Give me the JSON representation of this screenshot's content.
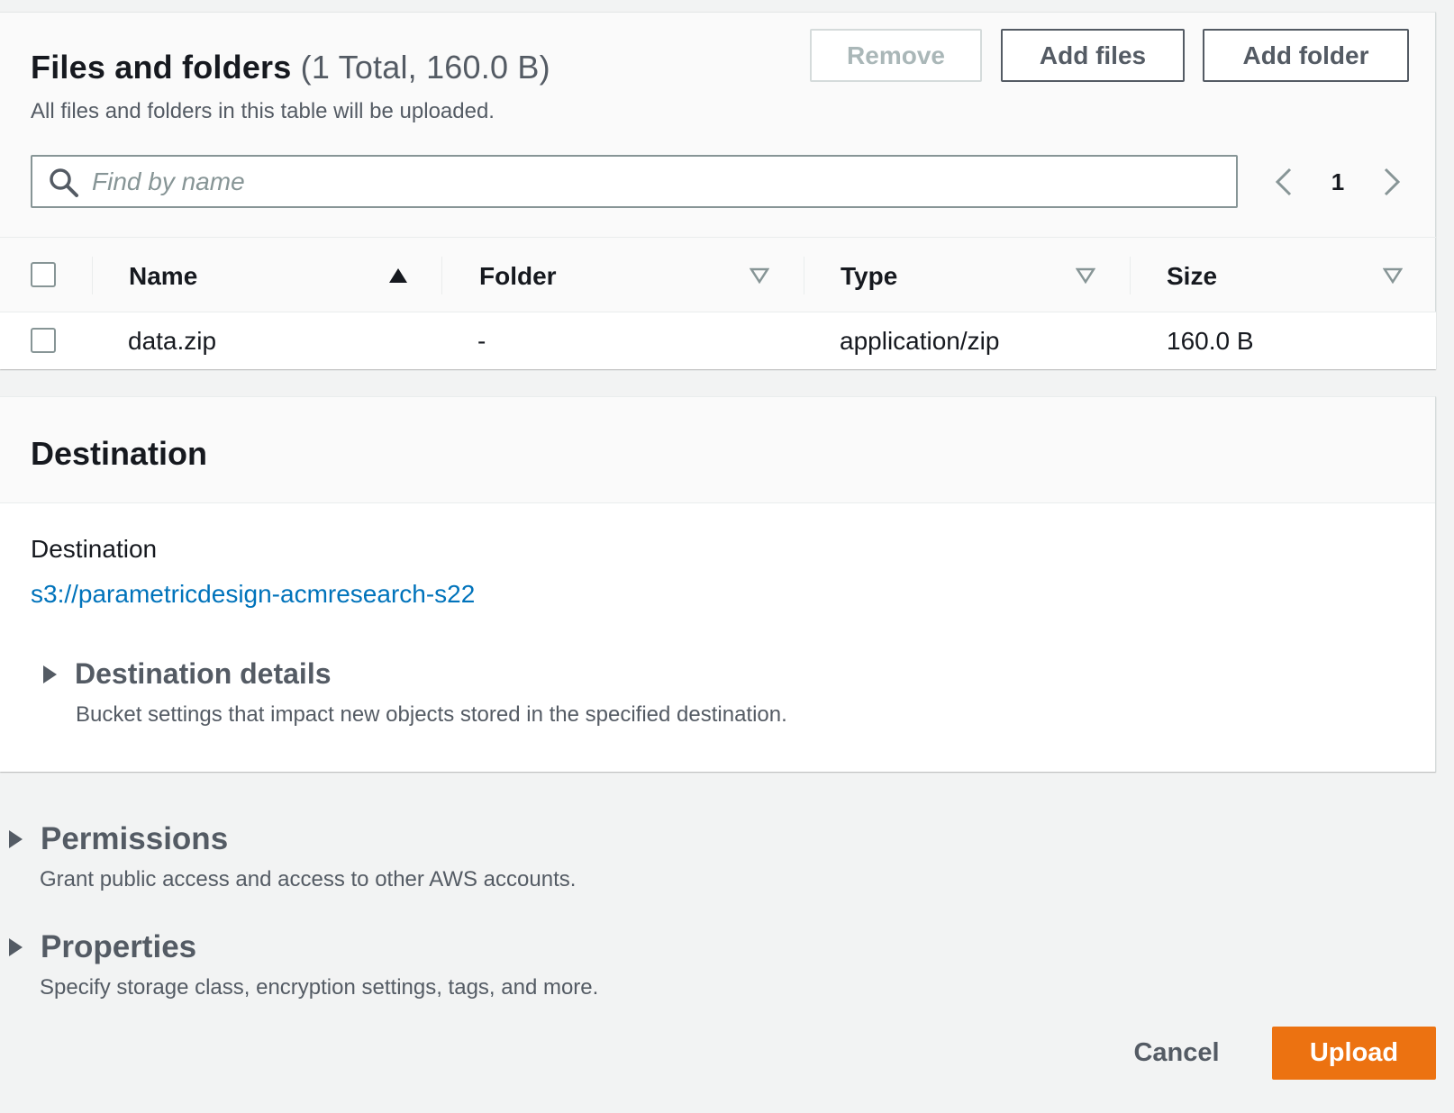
{
  "files_panel": {
    "title": "Files and folders",
    "counter": "(1 Total, 160.0 B)",
    "description": "All files and folders in this table will be uploaded.",
    "buttons": {
      "remove": "Remove",
      "add_files": "Add files",
      "add_folder": "Add folder"
    },
    "search": {
      "placeholder": "Find by name",
      "value": ""
    },
    "pagination": {
      "current_page": "1"
    },
    "table": {
      "columns": [
        {
          "label": "Name",
          "sort": "ascending"
        },
        {
          "label": "Folder",
          "sort": "none"
        },
        {
          "label": "Type",
          "sort": "none"
        },
        {
          "label": "Size",
          "sort": "none"
        }
      ],
      "rows": [
        {
          "name": "data.zip",
          "folder": "-",
          "type": "application/zip",
          "size": "160.0 B",
          "selected": false
        }
      ]
    }
  },
  "destination": {
    "title": "Destination",
    "label": "Destination",
    "url": "s3://parametricdesign-acmresearch-s22",
    "details": {
      "title": "Destination details",
      "description": "Bucket settings that impact new objects stored in the specified destination."
    }
  },
  "permissions": {
    "title": "Permissions",
    "description": "Grant public access and access to other AWS accounts."
  },
  "properties": {
    "title": "Properties",
    "description": "Specify storage class, encryption settings, tags, and more."
  },
  "footer": {
    "cancel": "Cancel",
    "upload": "Upload"
  },
  "colors": {
    "primary_button": "#ec7211",
    "link": "#0073bb",
    "text_secondary": "#545b64",
    "page_background": "#f2f3f3"
  }
}
